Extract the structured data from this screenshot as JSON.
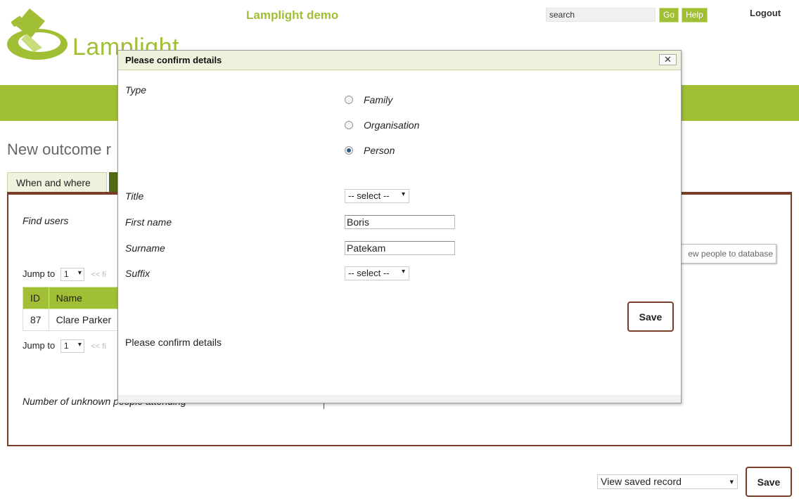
{
  "header": {
    "logo_text": "Lamplight",
    "app_title": "Lamplight demo",
    "search_placeholder": "search",
    "go_label": "Go",
    "help_label": "Help",
    "logout_label": "Logout"
  },
  "page": {
    "title": "New outcome r",
    "tabs": [
      {
        "label": "When and where"
      },
      {
        "label": ""
      }
    ],
    "find_users_label": "Find users",
    "jump_label": "Jump to",
    "jump_value": "1",
    "jump_nav": "<< fi",
    "table": {
      "headers": [
        "ID",
        "Name"
      ],
      "rows": [
        {
          "id": "87",
          "name": "Clare Parker"
        }
      ]
    },
    "add_people_label": "ew people to database",
    "unknown_label": "Number of unknown people attending",
    "view_select_value": "View saved record",
    "save_label": "Save"
  },
  "dialog": {
    "title": "Please confirm details",
    "close_label": "✕",
    "type_label": "Type",
    "type_options": [
      {
        "label": "Family",
        "checked": false
      },
      {
        "label": "Organisation",
        "checked": false
      },
      {
        "label": "Person",
        "checked": true
      }
    ],
    "title_label": "Title",
    "title_value": "-- select --",
    "first_name_label": "First name",
    "first_name_value": "Boris",
    "surname_label": "Surname",
    "surname_value": "Patekam",
    "suffix_label": "Suffix",
    "suffix_value": "-- select --",
    "save_label": "Save",
    "message": "Please confirm details"
  },
  "colors": {
    "brand_green": "#a1bf35",
    "accent_brown": "#7a3d28",
    "tab_dark": "#4f6b16"
  }
}
